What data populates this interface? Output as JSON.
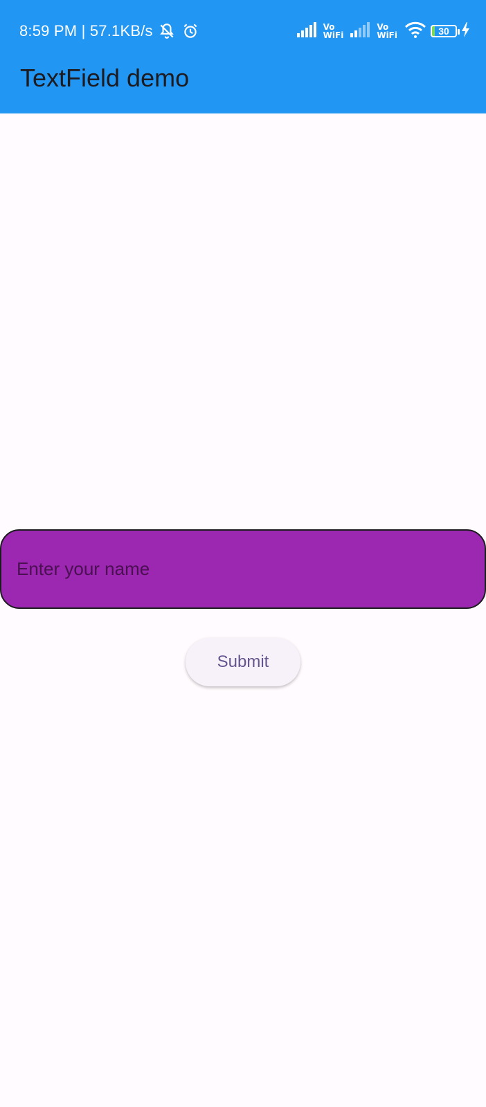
{
  "status_bar": {
    "time_speed": "8:59 PM | 57.1KB/s",
    "icons": [
      "muted-bell-icon",
      "alarm-clock-icon",
      "signal-icon",
      "vowifi-icon",
      "signal-weak-icon",
      "vowifi-icon",
      "wifi-icon",
      "battery-icon",
      "charging-icon"
    ],
    "vowifi_label": {
      "vo": "Vo",
      "wifi": "WiFi"
    },
    "battery_level": "30"
  },
  "app_bar": {
    "title": "TextField demo",
    "color": "#2196F3"
  },
  "form": {
    "name_placeholder": "Enter your name",
    "name_value": "",
    "field_color": "#9C27B0",
    "submit_label": "Submit",
    "submit_text_color": "#65558F"
  }
}
